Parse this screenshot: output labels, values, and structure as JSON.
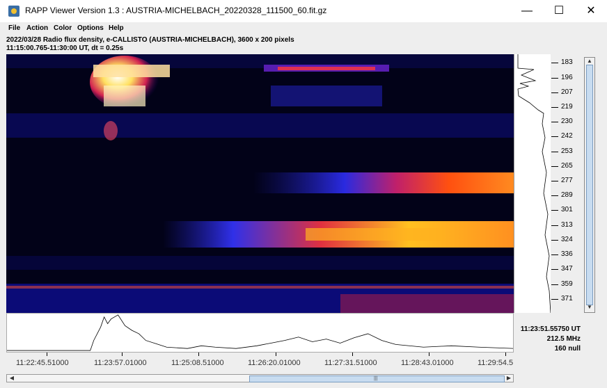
{
  "window": {
    "title": "RAPP Viewer Version 1.3 : AUSTRIA-MICHELBACH_20220328_111500_60.fit.gz",
    "minimize_glyph": "—",
    "maximize_glyph": "☐",
    "close_glyph": "✕"
  },
  "menu": [
    "File",
    "Action",
    "Color",
    "Options",
    "Help"
  ],
  "info": {
    "line1": "2022/03/28  Radio flux density, e-CALLISTO (AUSTRIA-MICHELBACH),  3600 x 200 pixels",
    "line2": "11:15:00.765-11:30:00 UT,  dt = 0.25s"
  },
  "freq_ticks": [
    "183",
    "196",
    "207",
    "219",
    "230",
    "242",
    "253",
    "265",
    "277",
    "289",
    "301",
    "313",
    "324",
    "336",
    "347",
    "359",
    "371"
  ],
  "time_ticks": [
    "11:22:45.51000",
    "11:23:57.01000",
    "11:25:08.51000",
    "11:26:20.01000",
    "11:27:31.51000",
    "11:28:43.01000",
    "11:29:54.5"
  ],
  "readout": {
    "time": "11:23:51.55750 UT",
    "freq": "212.5 MHz",
    "value": "160 null"
  },
  "scroll": {
    "up_arrow": "▲",
    "down_arrow": "▼",
    "left_arrow": "◀",
    "right_arrow": "▶",
    "grip": "|||"
  },
  "colors": {
    "window_bg": "#eeeeee",
    "spectrogram_bg": "#000010",
    "scroll_thumb": "#c8dcf0"
  }
}
